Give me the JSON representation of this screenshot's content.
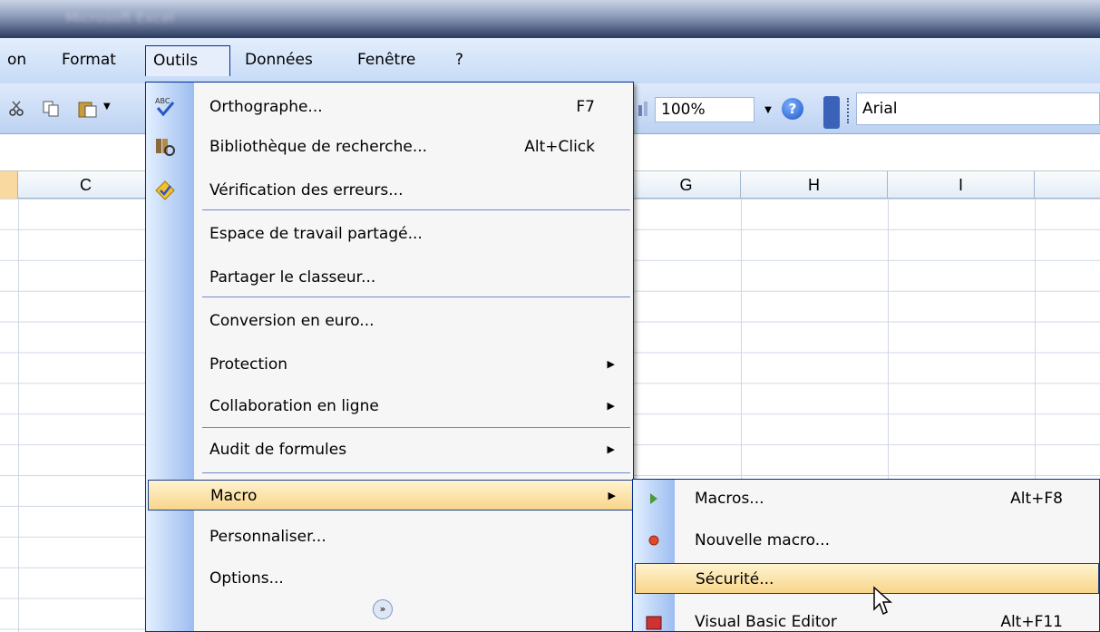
{
  "window": {
    "title": "Microsoft Excel"
  },
  "menubar": {
    "items": [
      {
        "id": "insertion",
        "label": "on"
      },
      {
        "id": "format",
        "label": "Format"
      },
      {
        "id": "outils",
        "label": "Outils"
      },
      {
        "id": "donnees",
        "label": "Données"
      },
      {
        "id": "fenetre",
        "label": "Fenêtre"
      },
      {
        "id": "help",
        "label": "?"
      }
    ]
  },
  "toolbar": {
    "zoom_value": "100%",
    "font_value": "Arial",
    "help_glyph": "?"
  },
  "grid": {
    "columns": [
      "C",
      "G",
      "H",
      "I"
    ]
  },
  "outils_menu": {
    "items": [
      {
        "label": "Orthographe...",
        "shortcut": "F7",
        "icon": "spelling-abc-icon"
      },
      {
        "label": "Bibliothèque de recherche...",
        "shortcut": "Alt+Click",
        "icon": "research-library-icon"
      },
      {
        "label": "Vérification des erreurs...",
        "icon": "error-checking-icon"
      },
      {
        "label": "Espace de travail partagé..."
      },
      {
        "label": "Partager le classeur..."
      },
      {
        "label": "Conversion en euro..."
      },
      {
        "label": "Protection",
        "submenu": true
      },
      {
        "label": "Collaboration en ligne",
        "submenu": true
      },
      {
        "label": "Audit de formules",
        "submenu": true
      },
      {
        "label": "Macro",
        "submenu": true,
        "highlighted": true
      },
      {
        "label": "Personnaliser..."
      },
      {
        "label": "Options..."
      }
    ],
    "expand_glyph": "»"
  },
  "macro_submenu": {
    "items": [
      {
        "label": "Macros...",
        "shortcut": "Alt+F8",
        "icon": "run-macro-icon"
      },
      {
        "label": "Nouvelle macro...",
        "icon": "record-macro-icon"
      },
      {
        "label": "Sécurité...",
        "highlighted": true
      },
      {
        "label": "Visual Basic Editor",
        "shortcut": "Alt+F11",
        "icon": "vb-editor-icon"
      }
    ]
  },
  "colors": {
    "accent_border": "#002d96",
    "highlight": "#f8d58a",
    "gutter": "#9dbdf0"
  }
}
